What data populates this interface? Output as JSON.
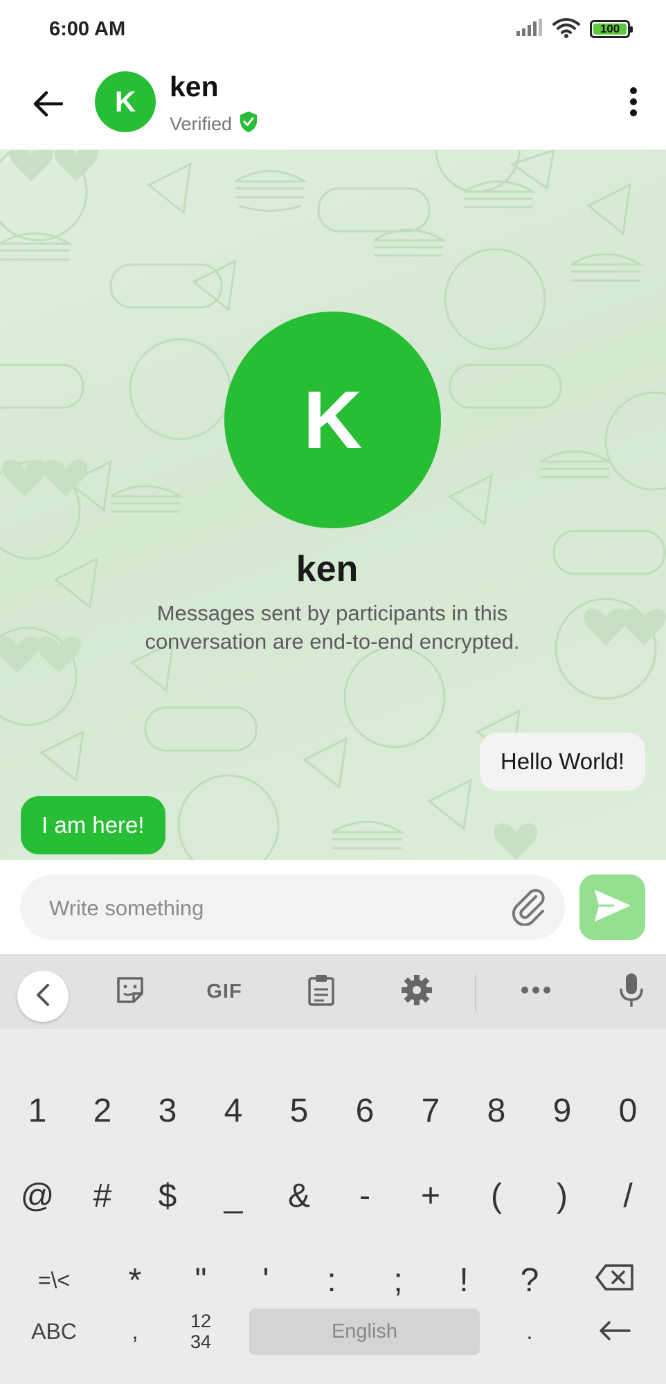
{
  "status_bar": {
    "time": "6:00 AM",
    "battery": "100",
    "icons": [
      "signal-icon",
      "wifi-icon",
      "battery-icon"
    ]
  },
  "header": {
    "avatar_letter": "K",
    "name": "ken",
    "status": "Verified",
    "icons": [
      "back-arrow-icon",
      "verified-shield-icon",
      "more-vertical-icon"
    ]
  },
  "chat": {
    "avatar_letter": "K",
    "name": "ken",
    "encryption_notice": "Messages sent by participants in this conversation are end-to-end encrypted.",
    "messages": [
      {
        "direction": "outgoing",
        "text": "Hello World!"
      },
      {
        "direction": "incoming",
        "text": "I am here!"
      }
    ]
  },
  "composer": {
    "placeholder": "Write something",
    "icons": [
      "paperclip-icon",
      "send-icon"
    ]
  },
  "keyboard": {
    "toolbar": {
      "gif_label": "GIF",
      "icons": [
        "chevron-left-icon",
        "sticker-icon",
        "clipboard-icon",
        "gear-icon",
        "more-horizontal-icon",
        "microphone-icon"
      ]
    },
    "rows": [
      [
        "1",
        "2",
        "3",
        "4",
        "5",
        "6",
        "7",
        "8",
        "9",
        "0"
      ],
      [
        "@",
        "#",
        "$",
        "_",
        "&",
        "-",
        "+",
        "(",
        ")",
        "/"
      ],
      [
        "=\\<",
        "*",
        "\"",
        "'",
        ":",
        ";",
        "!",
        "?"
      ],
      [
        "ABC",
        ",",
        "12\n34",
        "English",
        "."
      ]
    ],
    "space_label": "English",
    "colors": {
      "accent": "#27bd35",
      "send_button": "#93df8f"
    }
  }
}
